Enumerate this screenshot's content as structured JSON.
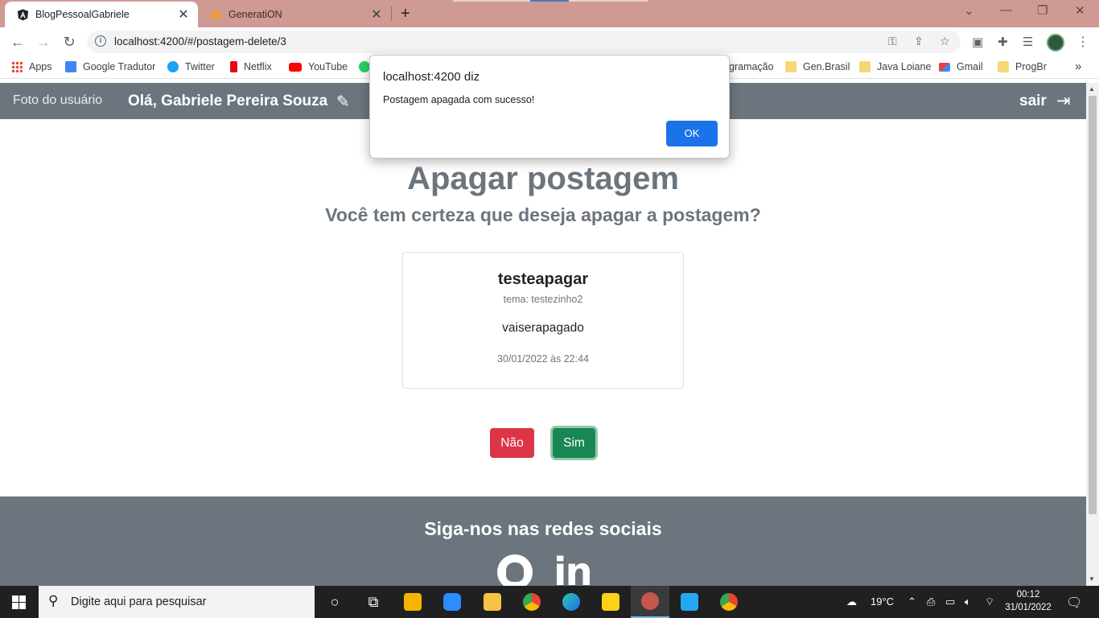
{
  "browser": {
    "tabs": [
      {
        "title": "BlogPessoalGabriele",
        "active": true,
        "favicon": "angular-icon"
      },
      {
        "title": "GenerationN_placeholder",
        "active": false,
        "favicon": "cloud-icon"
      }
    ],
    "url": "localhost:4200/#/postagem-delete/3",
    "bookmarks": [
      {
        "label": "Apps",
        "icon": "apps-grid-icon",
        "color": "#ea4335"
      },
      {
        "label": "Google Tradutor",
        "icon": "google-translate-icon",
        "color": "#4285f4"
      },
      {
        "label": "Twitter",
        "icon": "twitter-icon",
        "color": "#1da1f2"
      },
      {
        "label": "Netflix",
        "icon": "netflix-icon",
        "color": "#e50914"
      },
      {
        "label": "YouTube",
        "icon": "youtube-icon",
        "color": "#ff0000"
      },
      {
        "label": "gramação",
        "icon": "folder-icon",
        "color": "#f6d776"
      },
      {
        "label": "Gen.Brasil",
        "icon": "folder-icon",
        "color": "#f6d776"
      },
      {
        "label": "Java Loiane",
        "icon": "folder-icon",
        "color": "#f6d776"
      },
      {
        "label": "Gmail",
        "icon": "gmail-icon",
        "color": "#ea4335"
      },
      {
        "label": "ProgBr",
        "icon": "folder-icon",
        "color": "#f6d776"
      }
    ]
  },
  "navbar": {
    "photo_alt": "Foto do usuário",
    "greeting": "Olá, Gabriele Pereira Souza",
    "logout": "sair"
  },
  "page": {
    "title": "Apagar postagem",
    "subtitle": "Você tem certeza que deseja apagar a postagem?",
    "post": {
      "title": "testeapagar",
      "tema": "tema: testezinho2",
      "text": "vaiserapagado",
      "date": "30/01/2022 às 22:44"
    },
    "btn_no": "Não",
    "btn_yes": "Sim"
  },
  "footer": {
    "title": "Siga-nos nas redes sociais"
  },
  "dialog": {
    "header": "localhost:4200 diz",
    "message": "Postagem apagada com sucesso!",
    "ok": "OK"
  },
  "taskbar": {
    "search_placeholder": "Digite aqui para pesquisar",
    "temperature": "19°C",
    "time": "00:12",
    "date": "31/01/2022",
    "notifications": "1"
  },
  "colors": {
    "tabbar": "#cf9a94",
    "navbar": "#6c757d",
    "danger": "#dc3545",
    "success": "#198754",
    "dialog_ok": "#1a73e8"
  }
}
